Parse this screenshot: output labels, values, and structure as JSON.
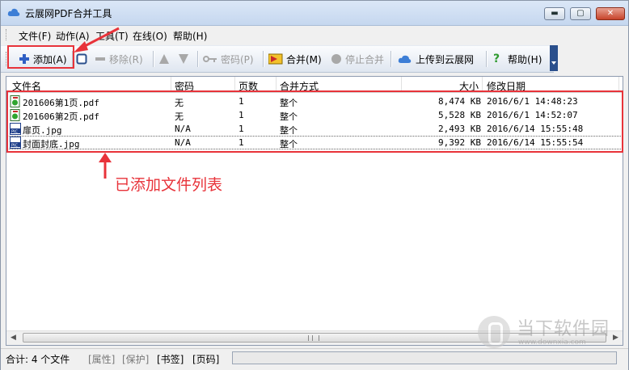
{
  "window": {
    "title": "云展网PDF合并工具"
  },
  "window_controls": {
    "minimize": "▬",
    "maximize": "▢",
    "close": "✕"
  },
  "menu": [
    "文件(F)",
    "动作(A)",
    "工具(T)",
    "在线(O)",
    "帮助(H)"
  ],
  "toolbar": {
    "add": "添加(A)",
    "remove": "移除(R)",
    "password": "密码(P)",
    "merge": "合并(M)",
    "stop": "停止合并",
    "upload": "上传到云展网",
    "help": "帮助(H)"
  },
  "columns": [
    "文件名",
    "密码",
    "页数",
    "合并方式",
    "大小",
    "修改日期"
  ],
  "files": [
    {
      "name": "201606第1页.pdf",
      "password": "无",
      "pages": "1",
      "mode": "整个",
      "size": "8,474 KB",
      "modified": "2016/6/1 14:48:23",
      "type": "pdf"
    },
    {
      "name": "201606第2页.pdf",
      "password": "无",
      "pages": "1",
      "mode": "整个",
      "size": "5,528 KB",
      "modified": "2016/6/1 14:52:07",
      "type": "pdf"
    },
    {
      "name": "扉页.jpg",
      "password": "N/A",
      "pages": "1",
      "mode": "整个",
      "size": "2,493 KB",
      "modified": "2016/6/14 15:55:48",
      "type": "jpg"
    },
    {
      "name": "封面封底.jpg",
      "password": "N/A",
      "pages": "1",
      "mode": "整个",
      "size": "9,392 KB",
      "modified": "2016/6/14 15:55:54",
      "type": "jpg"
    }
  ],
  "annotation": "已添加文件列表",
  "status": {
    "total": "合计: 4 个文件",
    "properties": "[属性]",
    "protect": "[保护]",
    "bookmark": "[书签]",
    "pagecode": "[页码]"
  },
  "watermark": {
    "title": "当下软件园",
    "url": "www.downxia.com"
  },
  "colors": {
    "annotation_red": "#e8333a",
    "titlebar": "#c5d7ef",
    "toolbar_overflow": "#2a4f8c"
  }
}
